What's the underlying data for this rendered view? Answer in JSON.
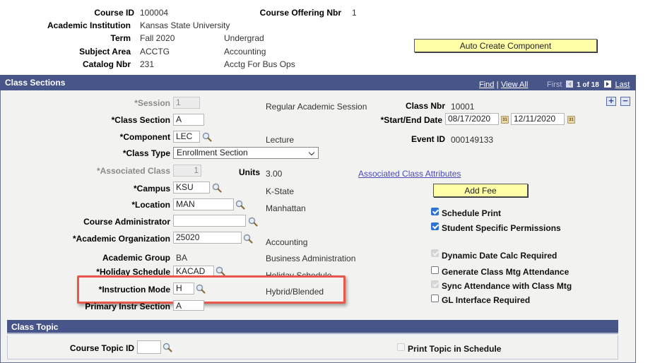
{
  "header": {
    "course_id_label": "Course ID",
    "course_id": "100004",
    "course_offering_label": "Course Offering Nbr",
    "course_offering": "1",
    "institution_label": "Academic Institution",
    "institution": "Kansas State University",
    "term_label": "Term",
    "term": "Fall 2020",
    "career": "Undergrad",
    "subject_label": "Subject Area",
    "subject": "ACCTG",
    "subject_desc": "Accounting",
    "catalog_label": "Catalog Nbr",
    "catalog": "231",
    "catalog_desc": "Acctg For Bus Ops",
    "auto_create_button": "Auto Create Component"
  },
  "class_sections": {
    "title": "Class Sections",
    "nav": {
      "find": "Find",
      "separator": "|",
      "view_all": "View All",
      "first": "First",
      "position": "1 of 18",
      "last": "Last"
    },
    "add_row": "+",
    "delete_row": "−",
    "fields": {
      "session_label": "*Session",
      "session": "1",
      "session_desc": "Regular Academic Session",
      "class_section_label": "*Class Section",
      "class_section": "A",
      "component_label": "*Component",
      "component": "LEC",
      "component_desc": "Lecture",
      "class_type_label": "*Class Type",
      "class_type": "Enrollment Section",
      "associated_class_label": "*Associated Class",
      "associated_class": "1",
      "units_label": "Units",
      "units": "3.00",
      "campus_label": "*Campus",
      "campus": "KSU",
      "campus_desc": "K-State",
      "location_label": "*Location",
      "location": "MAN",
      "location_desc": "Manhattan",
      "course_admin_label": "Course Administrator",
      "course_admin": "",
      "acad_org_label": "*Academic Organization",
      "acad_org": "25020",
      "acad_org_desc": "Accounting",
      "acad_group_label": "Academic Group",
      "acad_group": "BA",
      "acad_group_desc": "Business Administration",
      "holiday_label": "*Holiday Schedule",
      "holiday": "KACAD",
      "holiday_desc": "Holiday Schedule",
      "instr_mode_label": "*Instruction Mode",
      "instr_mode": "H",
      "instr_mode_desc": "Hybrid/Blended",
      "primary_instr_label": "Primary Instr Section",
      "primary_instr": "A",
      "class_nbr_label": "Class Nbr",
      "class_nbr": "10001",
      "dates_label": "*Start/End Date",
      "start_date": "08/17/2020",
      "end_date": "12/11/2020",
      "calendar_glyph": "31",
      "event_id_label": "Event ID",
      "event_id": "000149133",
      "assoc_attr_link": "Associated Class Attributes",
      "add_fee_button": "Add Fee"
    },
    "checkboxes": [
      {
        "label": "Schedule Print",
        "checked": true,
        "disabled": false
      },
      {
        "label": "Student Specific Permissions",
        "checked": true,
        "disabled": false
      },
      {
        "label": "Dynamic Date Calc Required",
        "checked": true,
        "disabled": true
      },
      {
        "label": "Generate Class Mtg Attendance",
        "checked": false,
        "disabled": false
      },
      {
        "label": "Sync Attendance with Class Mtg",
        "checked": true,
        "disabled": true
      },
      {
        "label": "GL Interface Required",
        "checked": false,
        "disabled": false
      }
    ]
  },
  "class_topic": {
    "title": "Class Topic",
    "course_topic_label": "Course Topic ID",
    "course_topic": "",
    "print_topic_label": "Print Topic in Schedule",
    "print_topic_checked": false
  },
  "colors": {
    "header_bar": "#485589",
    "panel_bg": "#f2f3f0",
    "button_yellow": "#ffffa8",
    "link": "#4a49b8",
    "highlight_red": "#e8574a"
  }
}
